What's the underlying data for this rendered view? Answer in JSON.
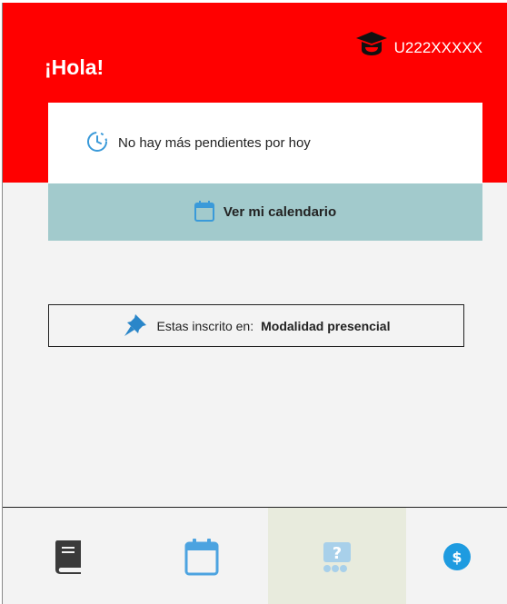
{
  "header": {
    "greeting": "¡Hola!",
    "user_code": "U222XXXXX",
    "user_icon": "graduation-cap-icon",
    "background_color": "#ff0000"
  },
  "pending": {
    "icon": "clock-icon",
    "text": "No hay más pendientes por hoy"
  },
  "calendar_button": {
    "icon": "calendar-icon",
    "label": "Ver mi calendario",
    "background_color": "#a2cacc"
  },
  "enrollment": {
    "icon": "pin-icon",
    "label": "Estas inscrito en:",
    "mode": "Modalidad presencial"
  },
  "bottom_nav": {
    "items": [
      {
        "icon": "book-icon",
        "active": false
      },
      {
        "icon": "calendar-icon",
        "active": false
      },
      {
        "icon": "help-chat-icon",
        "active": true
      },
      {
        "icon": "dollar-coin-icon",
        "active": false
      }
    ]
  }
}
